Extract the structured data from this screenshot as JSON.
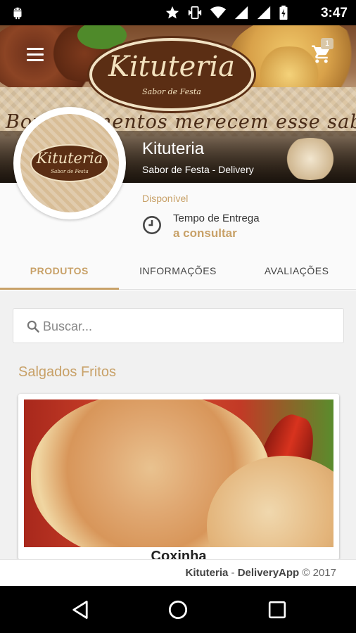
{
  "status_bar": {
    "time": "3:47"
  },
  "header": {
    "logo_text": "Kituteria",
    "logo_subtitle": "Sabor de Festa",
    "slogan": "Bons momentos merecem esse sabor!",
    "cart_count": "1"
  },
  "store": {
    "name": "Kituteria",
    "subtitle": "Sabor de Festa - Delivery",
    "availability": "Disponível",
    "delivery_label": "Tempo de Entrega",
    "delivery_value": "a consultar"
  },
  "tabs": [
    {
      "label": "PRODUTOS",
      "active": true
    },
    {
      "label": "INFORMAÇÕES",
      "active": false
    },
    {
      "label": "AVALIAÇÕES",
      "active": false
    }
  ],
  "search": {
    "placeholder": "Buscar..."
  },
  "section": {
    "title": "Salgados Fritos"
  },
  "product": {
    "name": "Coxinha"
  },
  "footer": {
    "brand": "Kituteria",
    "separator": " - ",
    "app": "DeliveryApp",
    "copyright": " © 2017"
  },
  "colors": {
    "accent": "#c8a168",
    "brown": "#5b2e14"
  }
}
